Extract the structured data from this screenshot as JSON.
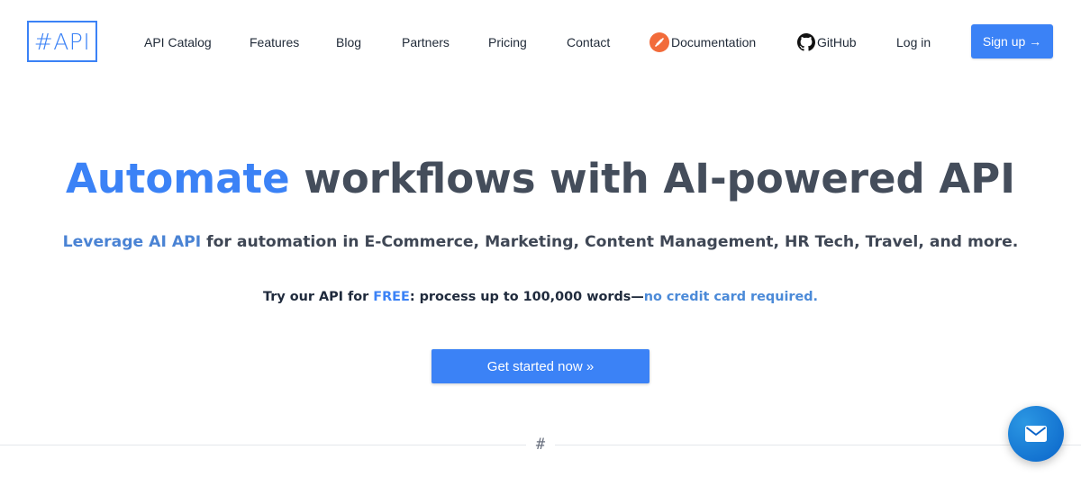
{
  "logo": {
    "text": "#API"
  },
  "nav": {
    "api_catalog": "API Catalog",
    "features": "Features",
    "blog": "Blog",
    "partners": "Partners",
    "pricing": "Pricing",
    "contact": "Contact",
    "documentation": "Documentation",
    "github": "GitHub",
    "login": "Log in",
    "signup": "Sign up →"
  },
  "hero": {
    "title_accent": "Automate",
    "title_rest": " workflows with AI-powered API",
    "subtitle_accent": "Leverage AI API",
    "subtitle_rest": " for automation in E-Commerce, Marketing, Content Management, HR Tech, Travel, and more.",
    "tagline_start": "Try our API for ",
    "tagline_free": "FREE",
    "tagline_mid": ": process up to 100,000 words—",
    "tagline_end": "no credit card required.",
    "cta_label": "Get started now »"
  },
  "divider": {
    "mark": "#"
  },
  "icons": {
    "documentation": "swagger-icon",
    "github": "github-icon",
    "chat": "mail-icon"
  },
  "colors": {
    "accent": "#3b82f6",
    "heading": "#444d5b",
    "documentation_icon": "#f26b3a",
    "chat_button": "#0a64c9"
  }
}
